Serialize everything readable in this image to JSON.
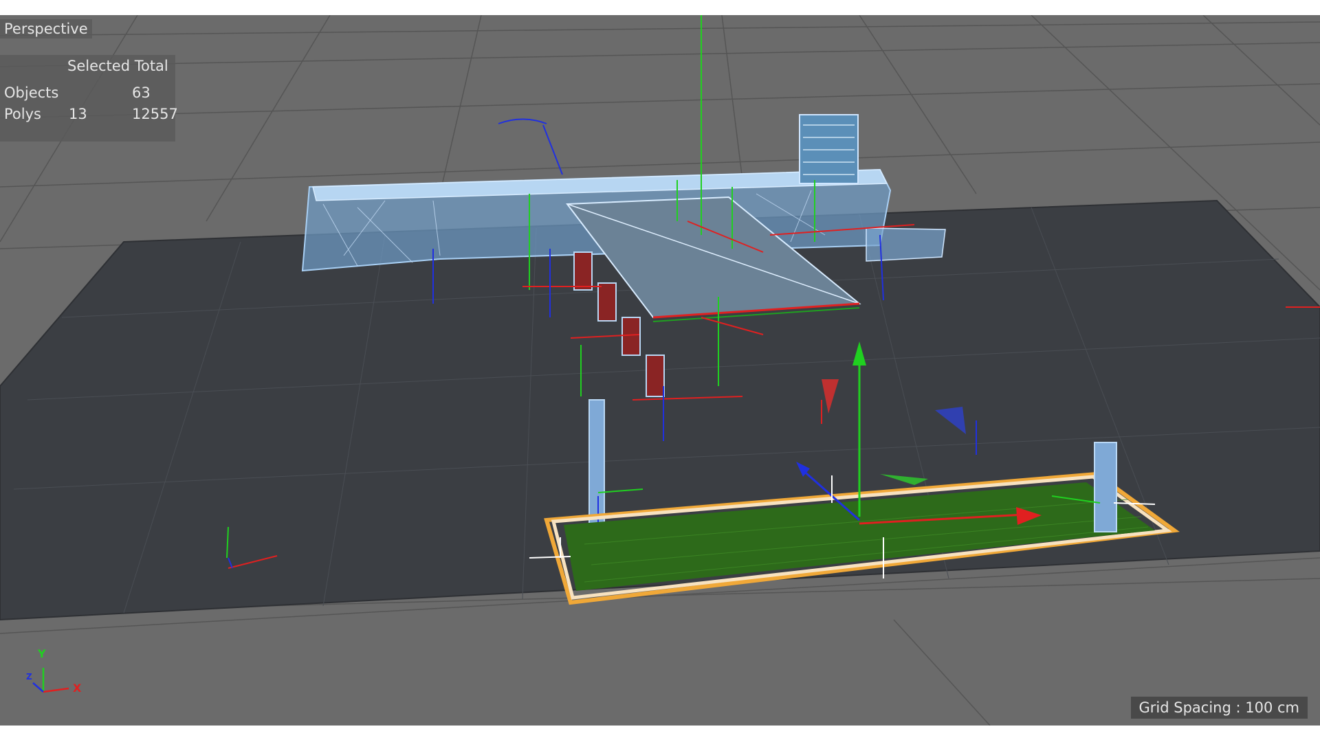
{
  "viewport": {
    "view_name": "Perspective",
    "grid_spacing": "Grid Spacing : 100 cm"
  },
  "stats": {
    "header": "Selected Total",
    "rows": [
      {
        "label": "Objects",
        "selected": "",
        "total": "63"
      },
      {
        "label": "Polys",
        "selected": "13",
        "total": "12557"
      }
    ]
  },
  "axis_indicator": {
    "y_label": "Y",
    "x_label": "X",
    "z_label": "Z"
  },
  "colors": {
    "background": "#6b6b6b",
    "ground_plane": "#3b3e43",
    "selection_blue": "#8fb8e6",
    "axis_x": "#e02020",
    "axis_y": "#20d020",
    "axis_z": "#2030e0",
    "selection_outline": "#f0a838",
    "grass": "#2d6a1a"
  }
}
